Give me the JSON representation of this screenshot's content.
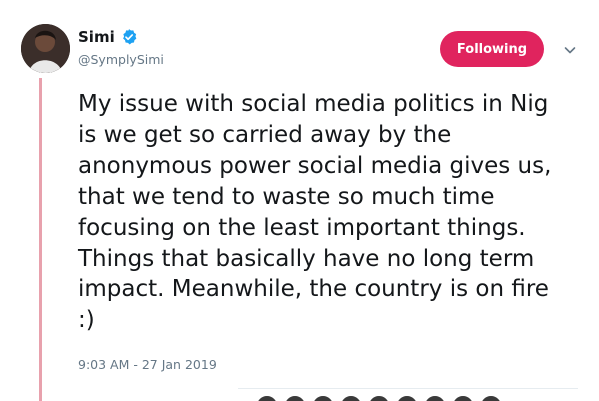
{
  "user": {
    "display_name": "Simi",
    "handle": "@SymplySimi",
    "verified_icon": "verified-badge-icon"
  },
  "follow_button": {
    "label": "Following"
  },
  "menu": {
    "icon": "chevron-down-icon"
  },
  "tweet": {
    "text": "My issue with social media politics in Nig\nis we get so carried away by the\nanonymous power social media gives us,\nthat we tend to waste so much time\nfocusing on the least important things.\nThings that basically have no long term\nimpact. Meanwhile, the country is on fire\n:)",
    "timestamp": "9:03 AM - 27 Jan 2019"
  },
  "colors": {
    "follow_button_bg": "#e0245e",
    "verified_blue": "#1da1f2",
    "thread_line": "#e8a1ad",
    "secondary_text": "#657786"
  }
}
